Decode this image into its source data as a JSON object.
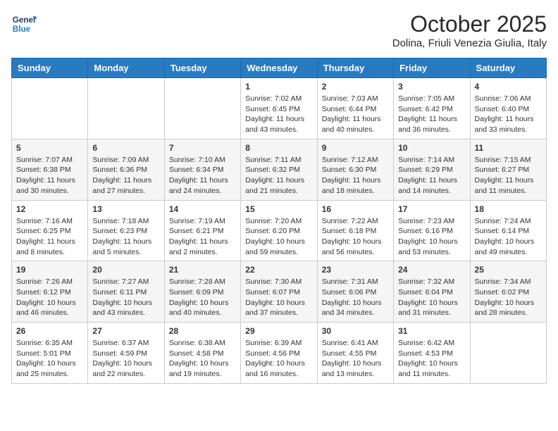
{
  "header": {
    "logo_line1": "General",
    "logo_line2": "Blue",
    "month": "October 2025",
    "location": "Dolina, Friuli Venezia Giulia, Italy"
  },
  "days_of_week": [
    "Sunday",
    "Monday",
    "Tuesday",
    "Wednesday",
    "Thursday",
    "Friday",
    "Saturday"
  ],
  "weeks": [
    [
      {
        "day": "",
        "info": ""
      },
      {
        "day": "",
        "info": ""
      },
      {
        "day": "",
        "info": ""
      },
      {
        "day": "1",
        "info": "Sunrise: 7:02 AM\nSunset: 6:45 PM\nDaylight: 11 hours and 43 minutes."
      },
      {
        "day": "2",
        "info": "Sunrise: 7:03 AM\nSunset: 6:44 PM\nDaylight: 11 hours and 40 minutes."
      },
      {
        "day": "3",
        "info": "Sunrise: 7:05 AM\nSunset: 6:42 PM\nDaylight: 11 hours and 36 minutes."
      },
      {
        "day": "4",
        "info": "Sunrise: 7:06 AM\nSunset: 6:40 PM\nDaylight: 11 hours and 33 minutes."
      }
    ],
    [
      {
        "day": "5",
        "info": "Sunrise: 7:07 AM\nSunset: 6:38 PM\nDaylight: 11 hours and 30 minutes."
      },
      {
        "day": "6",
        "info": "Sunrise: 7:09 AM\nSunset: 6:36 PM\nDaylight: 11 hours and 27 minutes."
      },
      {
        "day": "7",
        "info": "Sunrise: 7:10 AM\nSunset: 6:34 PM\nDaylight: 11 hours and 24 minutes."
      },
      {
        "day": "8",
        "info": "Sunrise: 7:11 AM\nSunset: 6:32 PM\nDaylight: 11 hours and 21 minutes."
      },
      {
        "day": "9",
        "info": "Sunrise: 7:12 AM\nSunset: 6:30 PM\nDaylight: 11 hours and 18 minutes."
      },
      {
        "day": "10",
        "info": "Sunrise: 7:14 AM\nSunset: 6:29 PM\nDaylight: 11 hours and 14 minutes."
      },
      {
        "day": "11",
        "info": "Sunrise: 7:15 AM\nSunset: 6:27 PM\nDaylight: 11 hours and 11 minutes."
      }
    ],
    [
      {
        "day": "12",
        "info": "Sunrise: 7:16 AM\nSunset: 6:25 PM\nDaylight: 11 hours and 8 minutes."
      },
      {
        "day": "13",
        "info": "Sunrise: 7:18 AM\nSunset: 6:23 PM\nDaylight: 11 hours and 5 minutes."
      },
      {
        "day": "14",
        "info": "Sunrise: 7:19 AM\nSunset: 6:21 PM\nDaylight: 11 hours and 2 minutes."
      },
      {
        "day": "15",
        "info": "Sunrise: 7:20 AM\nSunset: 6:20 PM\nDaylight: 10 hours and 59 minutes."
      },
      {
        "day": "16",
        "info": "Sunrise: 7:22 AM\nSunset: 6:18 PM\nDaylight: 10 hours and 56 minutes."
      },
      {
        "day": "17",
        "info": "Sunrise: 7:23 AM\nSunset: 6:16 PM\nDaylight: 10 hours and 53 minutes."
      },
      {
        "day": "18",
        "info": "Sunrise: 7:24 AM\nSunset: 6:14 PM\nDaylight: 10 hours and 49 minutes."
      }
    ],
    [
      {
        "day": "19",
        "info": "Sunrise: 7:26 AM\nSunset: 6:12 PM\nDaylight: 10 hours and 46 minutes."
      },
      {
        "day": "20",
        "info": "Sunrise: 7:27 AM\nSunset: 6:11 PM\nDaylight: 10 hours and 43 minutes."
      },
      {
        "day": "21",
        "info": "Sunrise: 7:28 AM\nSunset: 6:09 PM\nDaylight: 10 hours and 40 minutes."
      },
      {
        "day": "22",
        "info": "Sunrise: 7:30 AM\nSunset: 6:07 PM\nDaylight: 10 hours and 37 minutes."
      },
      {
        "day": "23",
        "info": "Sunrise: 7:31 AM\nSunset: 6:06 PM\nDaylight: 10 hours and 34 minutes."
      },
      {
        "day": "24",
        "info": "Sunrise: 7:32 AM\nSunset: 6:04 PM\nDaylight: 10 hours and 31 minutes."
      },
      {
        "day": "25",
        "info": "Sunrise: 7:34 AM\nSunset: 6:02 PM\nDaylight: 10 hours and 28 minutes."
      }
    ],
    [
      {
        "day": "26",
        "info": "Sunrise: 6:35 AM\nSunset: 5:01 PM\nDaylight: 10 hours and 25 minutes."
      },
      {
        "day": "27",
        "info": "Sunrise: 6:37 AM\nSunset: 4:59 PM\nDaylight: 10 hours and 22 minutes."
      },
      {
        "day": "28",
        "info": "Sunrise: 6:38 AM\nSunset: 4:58 PM\nDaylight: 10 hours and 19 minutes."
      },
      {
        "day": "29",
        "info": "Sunrise: 6:39 AM\nSunset: 4:56 PM\nDaylight: 10 hours and 16 minutes."
      },
      {
        "day": "30",
        "info": "Sunrise: 6:41 AM\nSunset: 4:55 PM\nDaylight: 10 hours and 13 minutes."
      },
      {
        "day": "31",
        "info": "Sunrise: 6:42 AM\nSunset: 4:53 PM\nDaylight: 10 hours and 11 minutes."
      },
      {
        "day": "",
        "info": ""
      }
    ]
  ]
}
